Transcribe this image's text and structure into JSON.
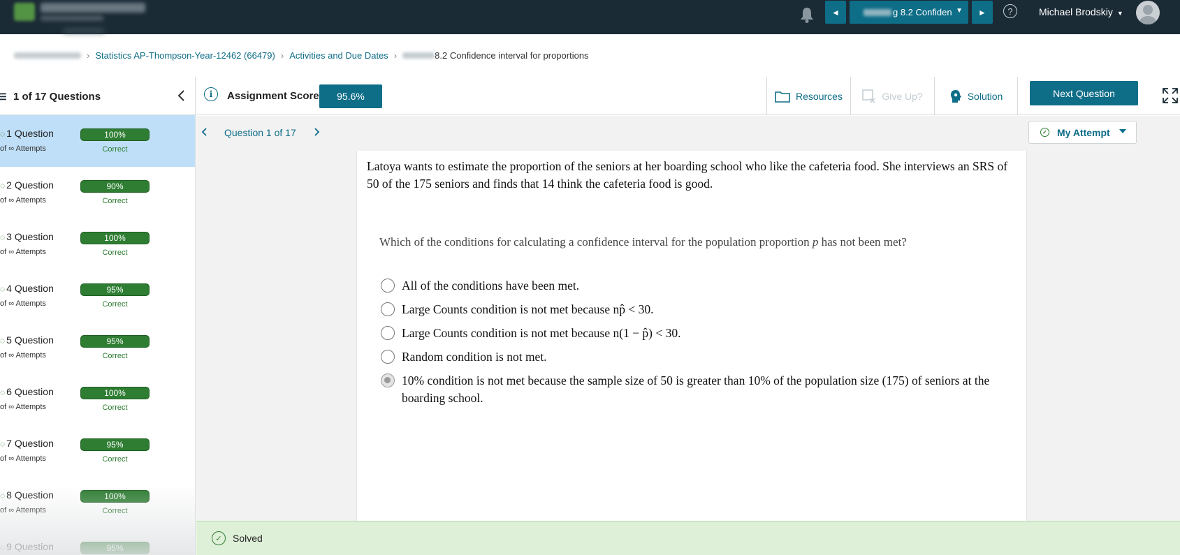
{
  "app": {
    "top_nav": {
      "prev_symbol": "◄",
      "next_symbol": "►",
      "assignment_select_suffix": "g 8.2 Confiden",
      "help_symbol": "?",
      "user_name": "Michael Brodskiy"
    }
  },
  "breadcrumb": {
    "items": [
      "Statistics AP-Thompson-Year-12462 (66479)",
      "Activities and Due Dates",
      "8.2 Confidence interval for proportions"
    ],
    "separator": "›"
  },
  "sidebar": {
    "title": "1 of 17 Questions",
    "items": [
      {
        "label": "1 Question",
        "attempts": "of ∞ Attempts",
        "score": "100%",
        "status": "Correct",
        "active": true
      },
      {
        "label": "2 Question",
        "attempts": "of ∞ Attempts",
        "score": "90%",
        "status": "Correct"
      },
      {
        "label": "3 Question",
        "attempts": "of ∞ Attempts",
        "score": "100%",
        "status": "Correct"
      },
      {
        "label": "4 Question",
        "attempts": "of ∞ Attempts",
        "score": "95%",
        "status": "Correct"
      },
      {
        "label": "5 Question",
        "attempts": "of ∞ Attempts",
        "score": "95%",
        "status": "Correct"
      },
      {
        "label": "6 Question",
        "attempts": "of ∞ Attempts",
        "score": "100%",
        "status": "Correct"
      },
      {
        "label": "7 Question",
        "attempts": "of ∞ Attempts",
        "score": "95%",
        "status": "Correct"
      },
      {
        "label": "8 Question",
        "attempts": "of ∞ Attempts",
        "score": "100%",
        "status": "Correct"
      },
      {
        "label": "9 Question",
        "attempts": "",
        "score": "95%",
        "status": ""
      }
    ]
  },
  "toolbar": {
    "score_label": "Assignment Score:",
    "score_value": "95.6%",
    "resources_label": "Resources",
    "giveup_label": "Give Up?",
    "solution_label": "Solution",
    "next_label": "Next Question"
  },
  "question_nav": {
    "label": "Question 1 of 17",
    "attempt_label": "My Attempt"
  },
  "question": {
    "stem": "Latoya wants to estimate the proportion of the seniors at her boarding school who like the cafeteria food. She interviews an SRS of 50 of the 175 seniors and finds that 14 think the cafeteria food is good.",
    "prompt_before": "Which of the conditions for calculating a confidence interval for the population proportion ",
    "prompt_var": "p",
    "prompt_after": " has not been met?",
    "options": [
      {
        "text": "All of the conditions have been met.",
        "selected": false
      },
      {
        "text": "Large Counts condition is not met because np̂ < 30.",
        "selected": false
      },
      {
        "text": "Large Counts condition is not met because n(1 − p̂) < 30.",
        "selected": false
      },
      {
        "text": "Random condition is not met.",
        "selected": false
      },
      {
        "text": "10% condition is not met because the sample size of 50 is greater than 10% of the population size (175) of seniors at the boarding school.",
        "selected": true
      }
    ]
  },
  "status_bar": {
    "label": "Solved"
  },
  "colors": {
    "topbar": "#1b2b36",
    "accent": "#0e6d87",
    "correct_green": "#2e7d32",
    "active_row": "#bfdff8",
    "solved_bg": "#dff0d8"
  }
}
